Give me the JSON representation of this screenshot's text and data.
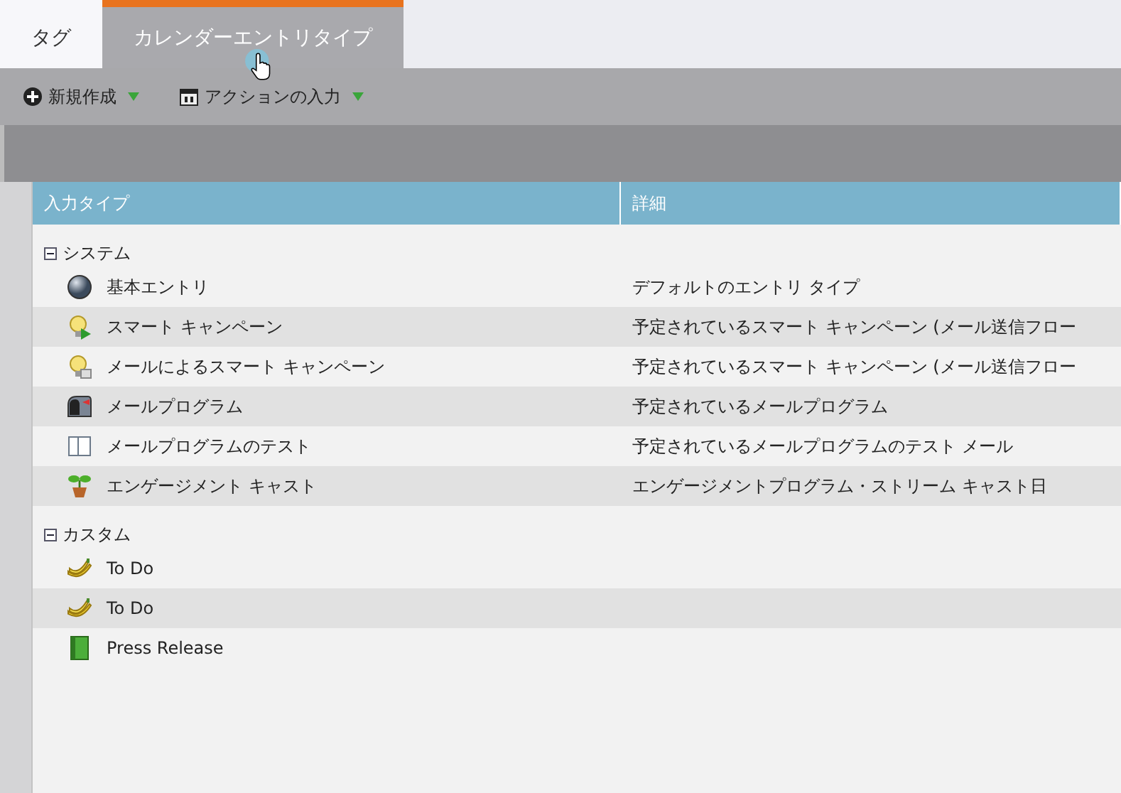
{
  "tabs": [
    {
      "label": "タグ",
      "selected": false
    },
    {
      "label": "カレンダーエントリタイプ",
      "selected": true
    }
  ],
  "toolbar": [
    {
      "label": "新規作成",
      "kind": "new"
    },
    {
      "label": "アクションの入力",
      "kind": "calendar"
    }
  ],
  "table": {
    "columns": [
      "入力タイプ",
      "詳細"
    ],
    "groups": [
      {
        "name": "システム",
        "expanded": true,
        "rows": [
          {
            "kind": "orb",
            "type": "基本エントリ",
            "detail": "デフォルトのエントリ タイプ"
          },
          {
            "kind": "bulb-play",
            "type": "スマート キャンペーン",
            "detail": "予定されているスマート キャンペーン (メール送信フロー"
          },
          {
            "kind": "bulb-mail",
            "type": "メールによるスマート キャンペーン",
            "detail": "予定されているスマート キャンペーン (メール送信フロー"
          },
          {
            "kind": "mailbox",
            "type": "メールプログラム",
            "detail": "予定されているメールプログラム"
          },
          {
            "kind": "panel",
            "type": "メールプログラムのテスト",
            "detail": "予定されているメールプログラムのテスト メール"
          },
          {
            "kind": "plant",
            "type": "エンゲージメント キャスト",
            "detail": "エンゲージメントプログラム・ストリーム キャスト日"
          }
        ]
      },
      {
        "name": "カスタム",
        "expanded": true,
        "rows": [
          {
            "kind": "banana",
            "type": "To Do"
          },
          {
            "kind": "banana",
            "type": "To Do"
          },
          {
            "kind": "book",
            "type": "Press Release"
          }
        ]
      }
    ]
  }
}
